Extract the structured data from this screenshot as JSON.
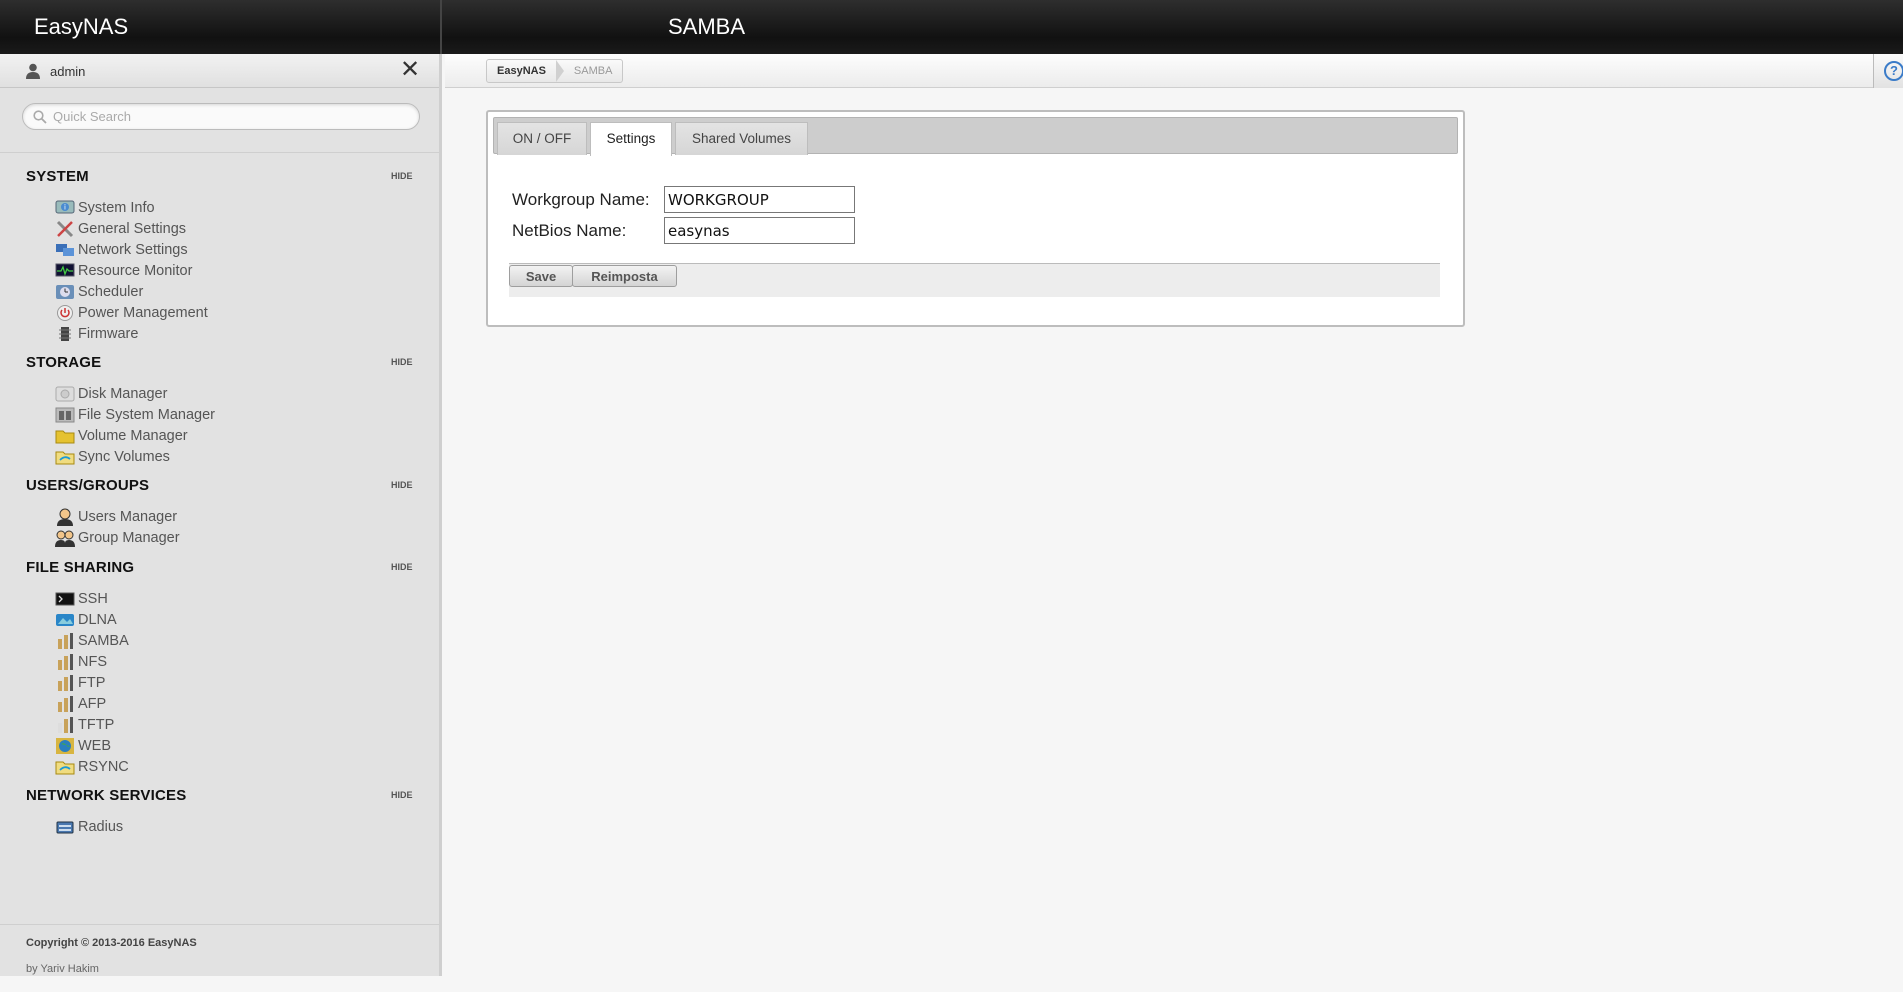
{
  "app": {
    "brand": "EasyNAS",
    "page_title": "SAMBA"
  },
  "user": {
    "name": "admin"
  },
  "search": {
    "placeholder": "Quick Search"
  },
  "sidebar": {
    "hide_label": "HIDE",
    "sections": {
      "system": {
        "title": "SYSTEM",
        "items": [
          "System Info",
          "General Settings",
          "Network Settings",
          "Resource Monitor",
          "Scheduler",
          "Power Management",
          "Firmware"
        ]
      },
      "storage": {
        "title": "STORAGE",
        "items": [
          "Disk Manager",
          "File System Manager",
          "Volume Manager",
          "Sync Volumes"
        ]
      },
      "users": {
        "title": "USERS/GROUPS",
        "items": [
          "Users Manager",
          "Group Manager"
        ]
      },
      "sharing": {
        "title": "FILE SHARING",
        "items": [
          "SSH",
          "DLNA",
          "SAMBA",
          "NFS",
          "FTP",
          "AFP",
          "TFTP",
          "WEB",
          "RSYNC"
        ]
      },
      "network": {
        "title": "NETWORK SERVICES",
        "items": [
          "Radius"
        ]
      }
    },
    "footer": {
      "copyright": "Copyright © 2013-2016 EasyNAS",
      "byline": "by Yariv Hakim"
    }
  },
  "breadcrumb": [
    "EasyNAS",
    "SAMBA"
  ],
  "tabs": [
    "ON / OFF",
    "Settings",
    "Shared Volumes"
  ],
  "active_tab": "Settings",
  "form": {
    "workgroup_label": "Workgroup Name:",
    "workgroup_value": "WORKGROUP",
    "netbios_label": "NetBios Name:",
    "netbios_value": "easynas",
    "save_label": "Save",
    "reset_label": "Reimposta"
  },
  "colors": {
    "accent": "#3a7bc8",
    "topbar": "#1a1a1a",
    "sidebar": "#e2e2e2"
  }
}
